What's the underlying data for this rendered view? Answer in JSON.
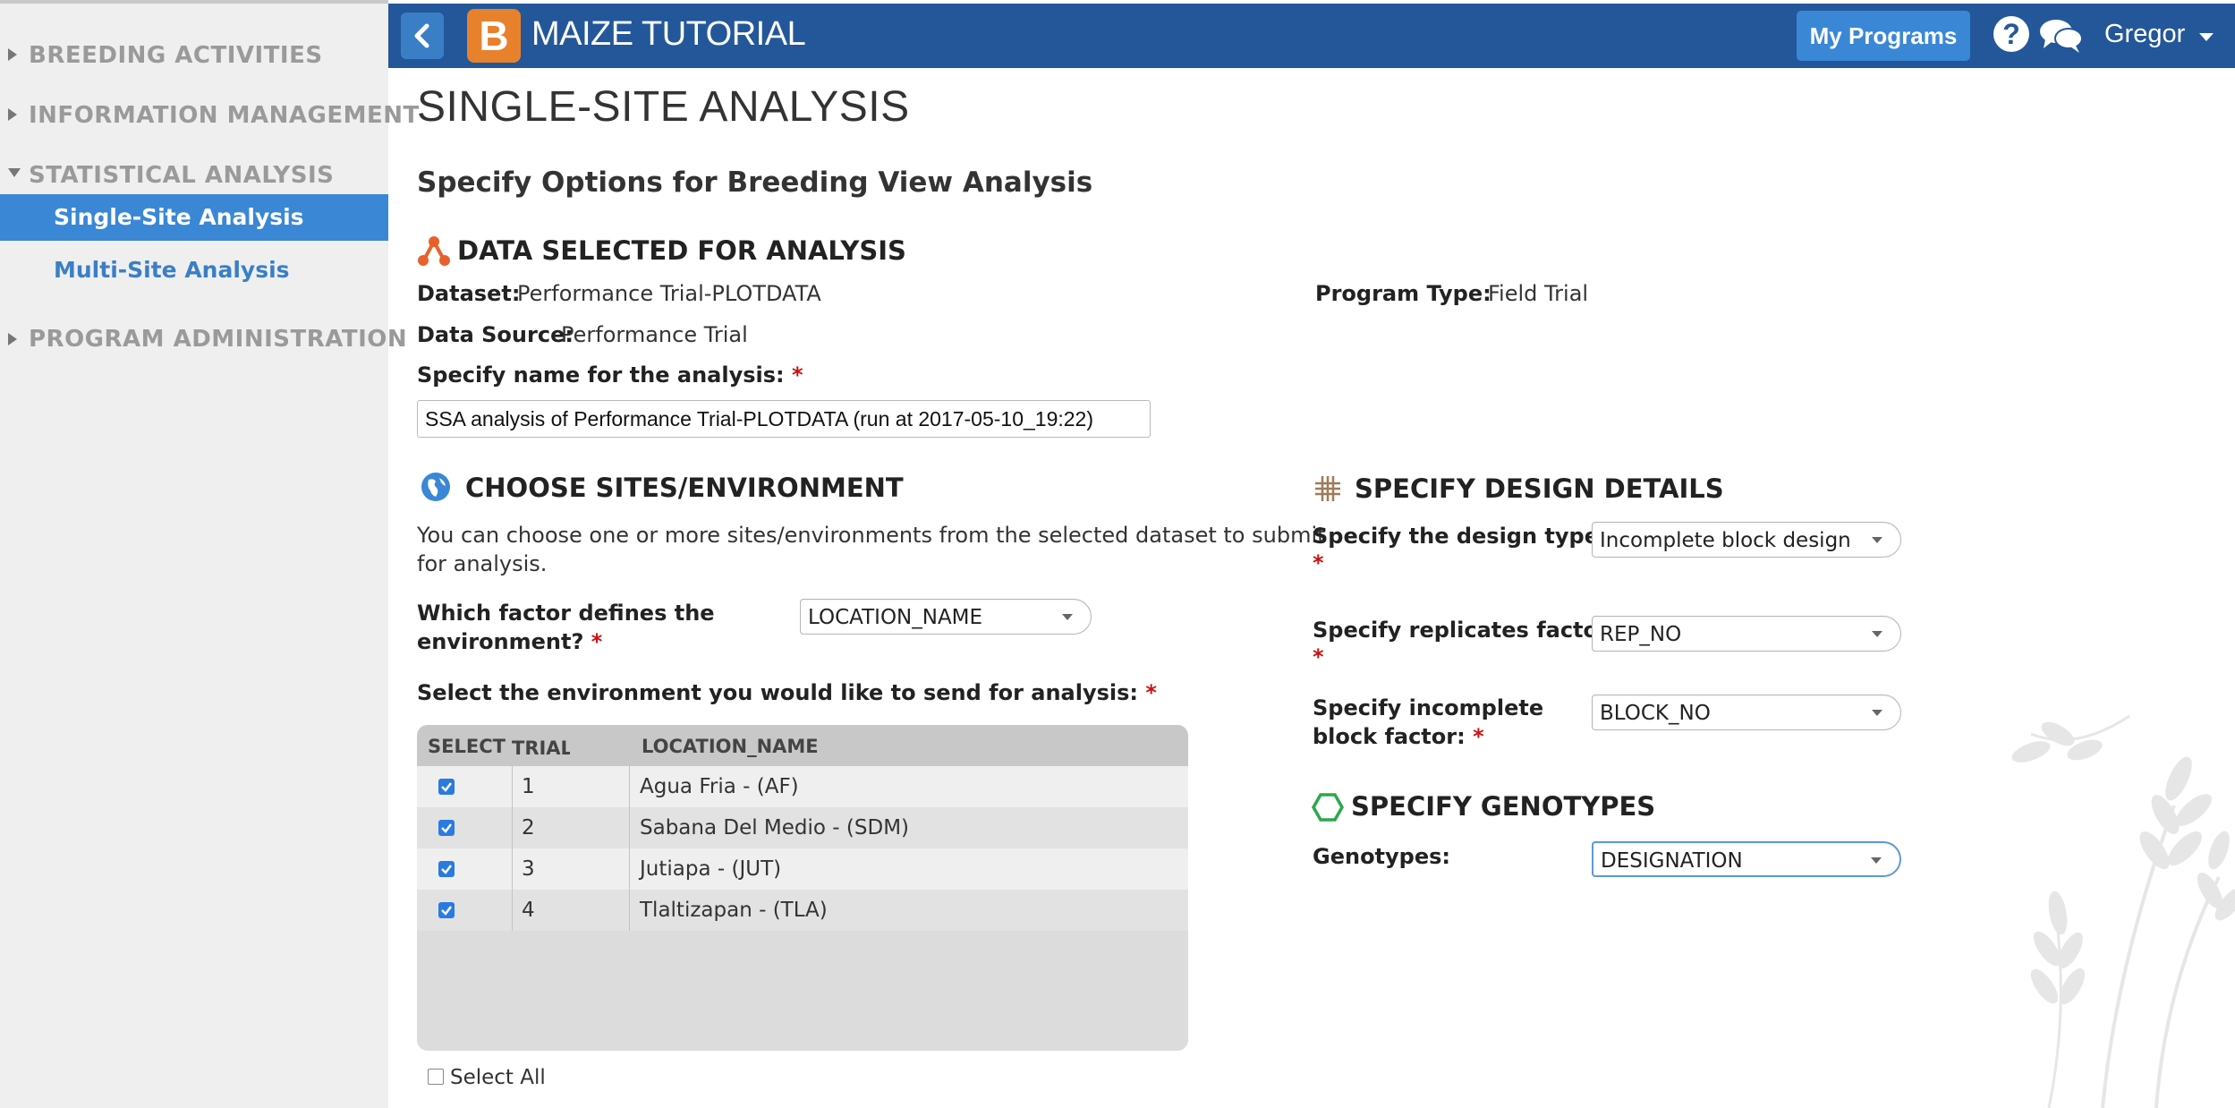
{
  "sidebar": {
    "groups": [
      {
        "label": "BREEDING ACTIVITIES"
      },
      {
        "label": "INFORMATION MANAGEMENT"
      },
      {
        "label": "STATISTICAL ANALYSIS"
      },
      {
        "label": "PROGRAM ADMINISTRATION"
      }
    ],
    "items": [
      {
        "label": "Single-Site Analysis"
      },
      {
        "label": "Multi-Site Analysis"
      }
    ]
  },
  "header": {
    "logo_letter": "B",
    "app_title": "MAIZE TUTORIAL",
    "my_programs": "My Programs",
    "help": "?",
    "user": "Gregor",
    "colors": {
      "bar": "#23579a",
      "accent": "#3a87d6",
      "logo": "#e8812c"
    }
  },
  "page": {
    "title": "SINGLE-SITE ANALYSIS",
    "subtitle": "Specify Options for Breeding View Analysis"
  },
  "data_section": {
    "heading": "DATA SELECTED FOR ANALYSIS",
    "dataset_label": "Dataset:",
    "dataset_value": "Performance Trial-PLOTDATA",
    "source_label": "Data Source:",
    "source_value": "Performance Trial",
    "program_type_label": "Program Type:",
    "program_type_value": "Field Trial",
    "name_label": "Specify name for the analysis:",
    "name_value": "SSA analysis of Performance Trial-PLOTDATA  (run at 2017-05-10_19:22)",
    "required_mark": "*"
  },
  "sites_section": {
    "heading": "CHOOSE SITES/ENVIRONMENT",
    "description_line1": "You can choose one or more sites/environments from the selected dataset to submit",
    "description_line2": "for analysis.",
    "factor_label_line1": "Which factor defines the",
    "factor_label_line2": "environment?",
    "factor_value": "LOCATION_NAME",
    "select_env_label": "Select the environment you would like to send for analysis:",
    "table": {
      "headers": [
        "SELECT",
        "TRIAL_INST",
        "LOCATION_NAME"
      ],
      "rows": [
        {
          "checked": true,
          "trial": "1",
          "location": "Agua Fria - (AF)"
        },
        {
          "checked": true,
          "trial": "2",
          "location": "Sabana Del Medio - (SDM)"
        },
        {
          "checked": true,
          "trial": "3",
          "location": "Jutiapa - (JUT)"
        },
        {
          "checked": true,
          "trial": "4",
          "location": "Tlaltizapan - (TLA)"
        }
      ]
    },
    "select_all": "Select All"
  },
  "design_section": {
    "heading": "SPECIFY DESIGN DETAILS",
    "design_type_label": "Specify the design type:",
    "design_type_value": "Incomplete block design",
    "replicates_label": "Specify replicates factor:",
    "replicates_value": "REP_NO",
    "block_label_line1": "Specify incomplete",
    "block_label_line2": "block factor:",
    "block_value": "BLOCK_NO"
  },
  "genotypes_section": {
    "heading": "SPECIFY GENOTYPES",
    "label": "Genotypes:",
    "value": "DESIGNATION"
  }
}
